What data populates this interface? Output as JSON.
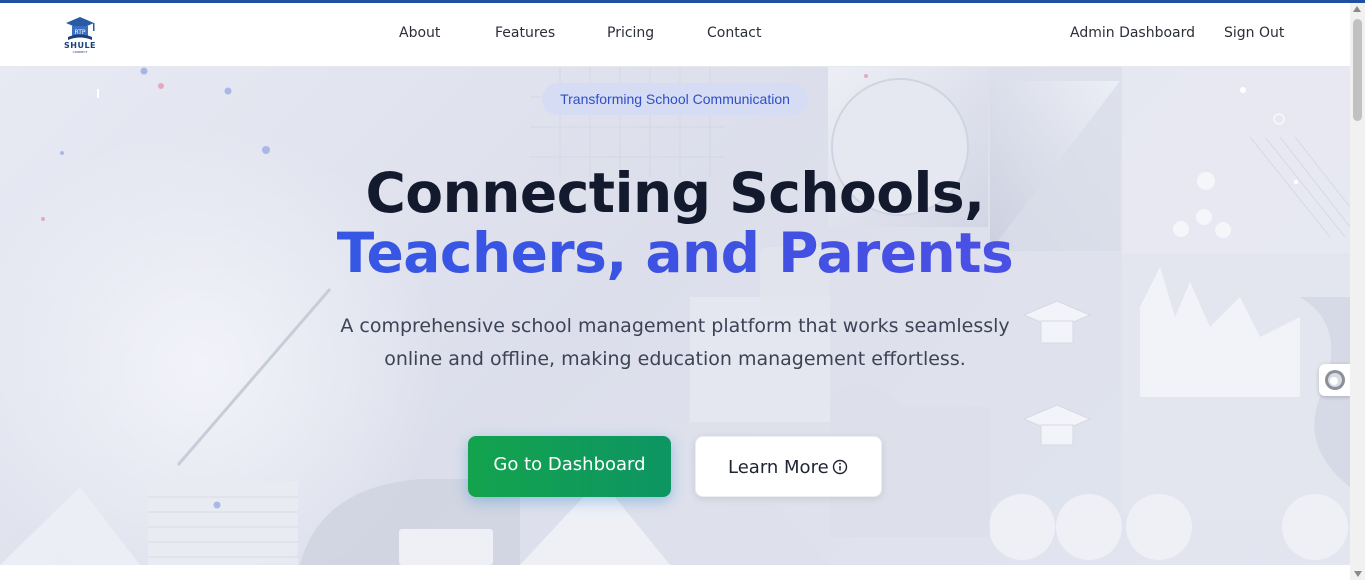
{
  "brand": {
    "logo_text": "SHULE",
    "logo_subtext": "CONNECT",
    "logo_badge": "RTP"
  },
  "nav": {
    "links": [
      {
        "label": "About"
      },
      {
        "label": "Features"
      },
      {
        "label": "Pricing"
      },
      {
        "label": "Contact"
      }
    ],
    "admin_dashboard": "Admin Dashboard",
    "sign_out": "Sign Out"
  },
  "hero": {
    "badge": "Transforming School Communication",
    "title_line1": "Connecting Schools,",
    "title_line2": "Teachers, and Parents",
    "subtitle_line1": "A comprehensive school management platform that works seamlessly",
    "subtitle_line2": "online and offline, making education management effortless.",
    "primary_button": "Go to Dashboard",
    "secondary_button": "Learn More",
    "secondary_icon": "info-icon"
  },
  "colors": {
    "accent_blue": "#3a55e0",
    "primary_green": "#13a34d",
    "heading_dark": "#141a2e",
    "top_bar": "#1f4fa3"
  },
  "widgets": {
    "floating_icon": "accessibility-widget-icon"
  }
}
